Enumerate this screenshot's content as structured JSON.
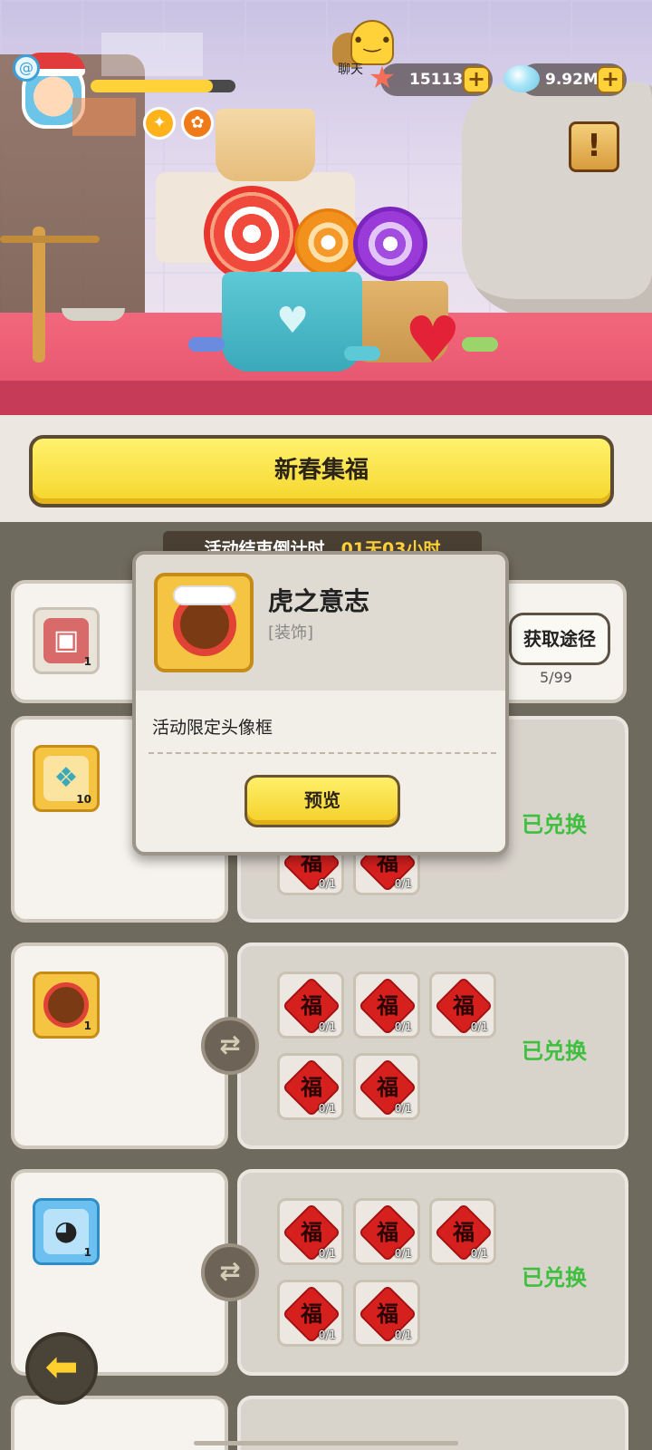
{
  "top_bar": {
    "chat_label": "聊天",
    "starfish_count": "15113",
    "gem_count": "9.92M",
    "plus_symbol": "+",
    "quest_symbol": "!"
  },
  "banner": {
    "title": "新春集福"
  },
  "countdown": {
    "label": "活动结束倒计时",
    "time": "01天03小时"
  },
  "row1": {
    "reward_count": "1",
    "button_label": "获取途径",
    "progress": "5/99"
  },
  "row2": {
    "reward_count": "10",
    "status": "已兑换",
    "fu_counts": [
      "0/1",
      "0/1"
    ]
  },
  "row3": {
    "reward_count": "1",
    "status": "已兑换",
    "fu": [
      {
        "char": "福",
        "count": "0/1"
      },
      {
        "char": "福",
        "count": "0/1"
      },
      {
        "char": "福",
        "count": "0/1"
      },
      {
        "char": "福",
        "count": "0/1"
      },
      {
        "char": "福",
        "count": "0/1"
      }
    ]
  },
  "row4": {
    "reward_count": "1",
    "status": "已兑换",
    "fu": [
      {
        "char": "福",
        "count": "0/1"
      },
      {
        "char": "福",
        "count": "0/1"
      },
      {
        "char": "福",
        "count": "0/1"
      },
      {
        "char": "福",
        "count": "0/1"
      },
      {
        "char": "福",
        "count": "0/1"
      }
    ]
  },
  "popup": {
    "title": "虎之意志",
    "type": "[装饰]",
    "description": "活动限定头像框",
    "preview_button": "预览"
  },
  "colors": {
    "accent_yellow": "#f6d52b",
    "done_green": "#3fbf3f",
    "fu_red": "#d6201e"
  },
  "icons": [
    "starfish-icon",
    "gem-icon",
    "chat-icon",
    "quest-icon",
    "back-arrow-icon",
    "swap-icon"
  ]
}
